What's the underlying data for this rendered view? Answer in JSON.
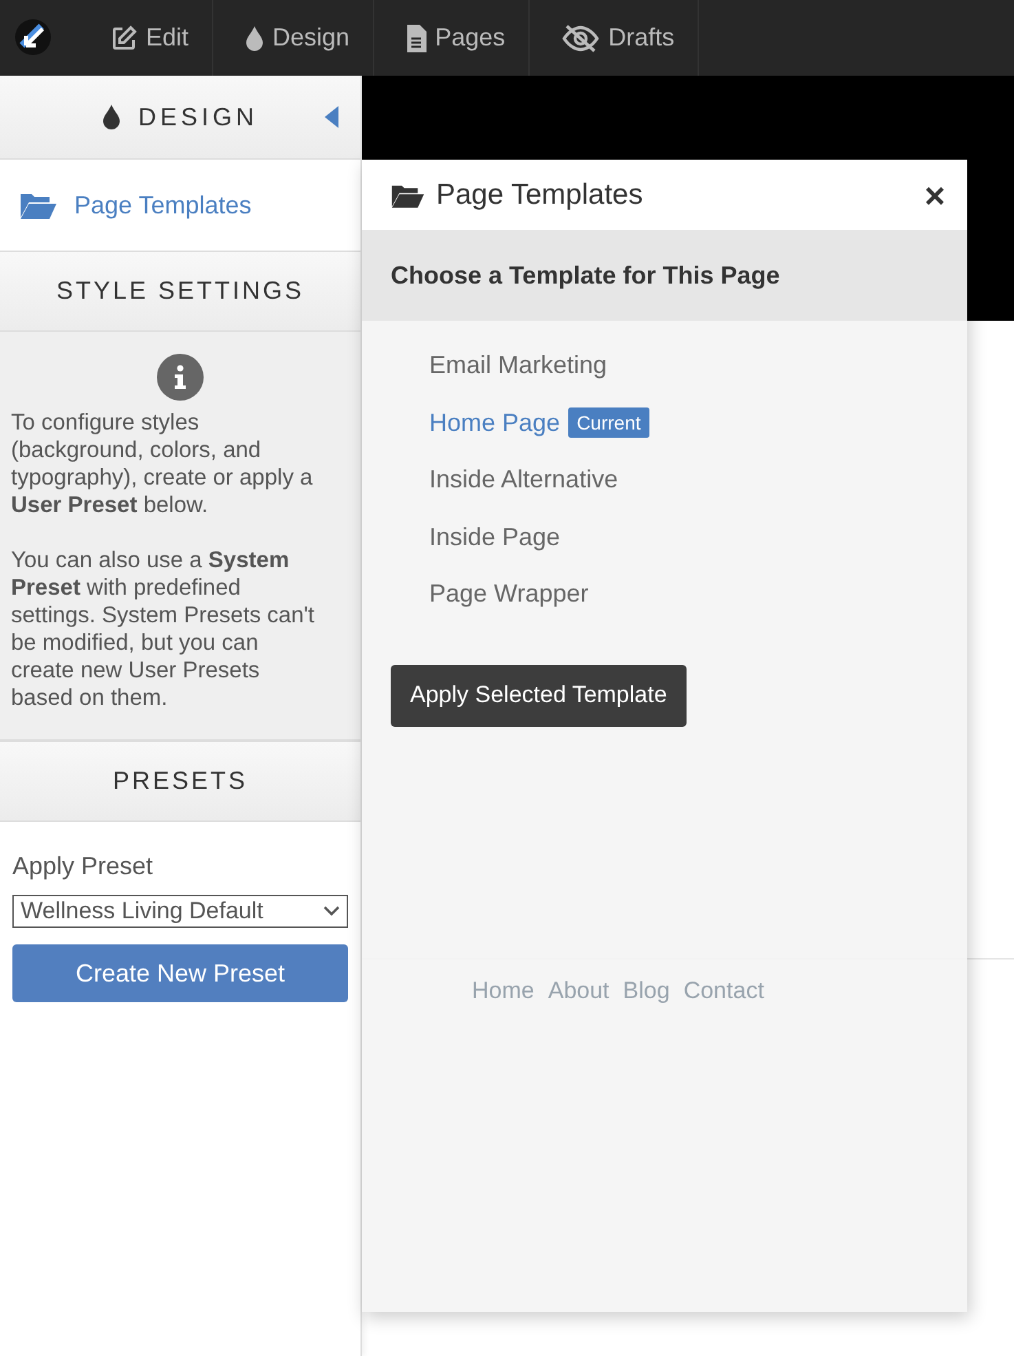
{
  "toolbar": {
    "items": [
      {
        "label": "Edit"
      },
      {
        "label": "Design"
      },
      {
        "label": "Pages"
      },
      {
        "label": "Drafts"
      }
    ]
  },
  "sidebar": {
    "title": "DESIGN",
    "templates_link": "Page Templates",
    "style_heading": "STYLE SETTINGS",
    "info": [
      "To configure styles (background, colors, and typography), create or apply a **User Preset** below.",
      "You can also use a **System Preset** with predefined settings. System Presets can't be modified, but you can create new User Presets based on them."
    ],
    "presets_heading": "PRESETS",
    "apply_label": "Apply Preset",
    "preset_value": "Wellness Living Default",
    "create_button": "Create New Preset"
  },
  "preview": {
    "nav": [
      "Home",
      "About",
      "Blog",
      "Contact"
    ]
  },
  "dialog": {
    "title": "Page Templates",
    "close": "×",
    "subtitle": "Choose a Template for This Page",
    "templates": [
      {
        "name": "Email Marketing",
        "selected": false
      },
      {
        "name": "Home Page",
        "selected": true,
        "badge": "Current"
      },
      {
        "name": "Inside Alternative",
        "selected": false
      },
      {
        "name": "Inside Page",
        "selected": false
      },
      {
        "name": "Page Wrapper",
        "selected": false
      }
    ],
    "apply_button": "Apply Selected Template"
  }
}
